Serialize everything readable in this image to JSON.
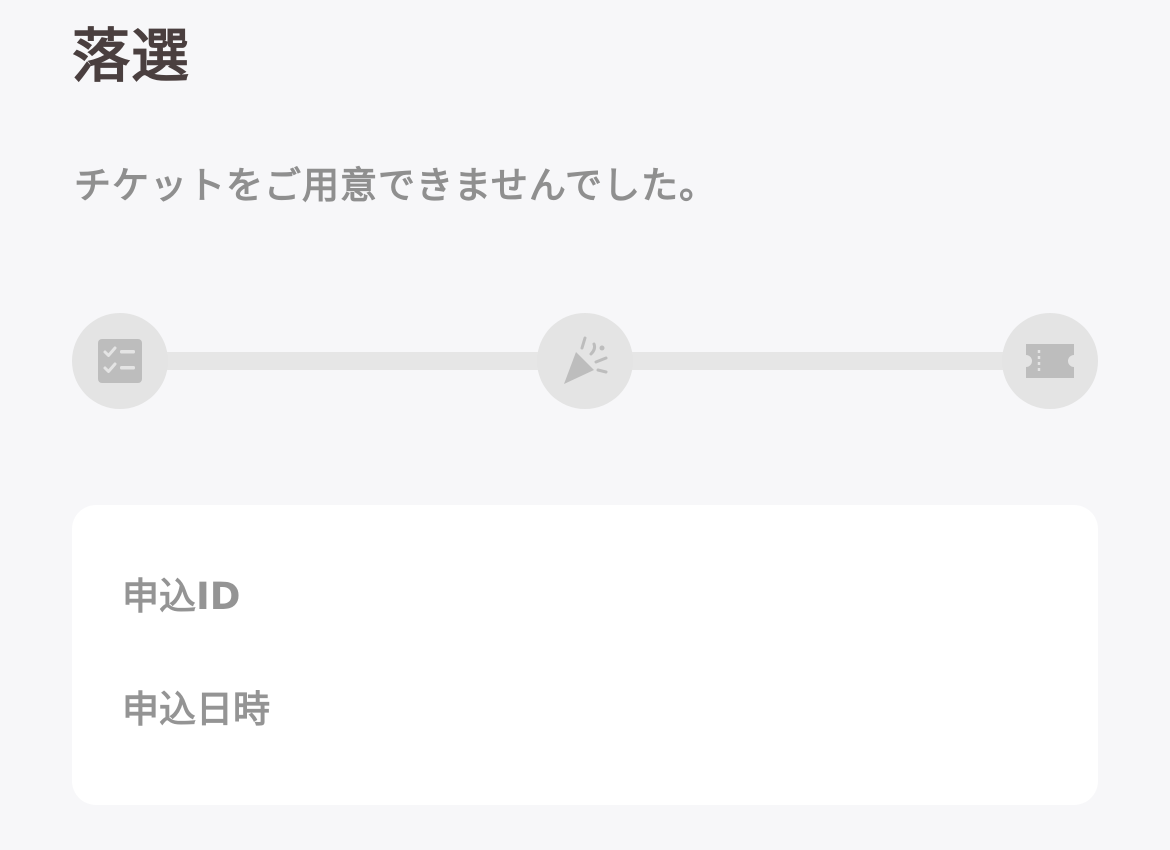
{
  "header": {
    "title": "落選",
    "message": "チケットをご用意できませんでした。"
  },
  "progress": {
    "steps": [
      {
        "icon": "checklist-icon",
        "state": "inactive"
      },
      {
        "icon": "party-popper-icon",
        "state": "inactive"
      },
      {
        "icon": "ticket-icon",
        "state": "inactive"
      }
    ],
    "colors": {
      "circle": "#e4e4e4",
      "track": "#e6e6e6",
      "icon": "#bdbdbd"
    }
  },
  "details": {
    "application_id_label": "申込ID",
    "application_id_value": "",
    "application_datetime_label": "申込日時",
    "application_datetime_value": ""
  },
  "colors": {
    "background": "#f7f7f9",
    "title": "#4a3f3f",
    "muted_text": "#8f8f8f",
    "card": "#ffffff"
  }
}
